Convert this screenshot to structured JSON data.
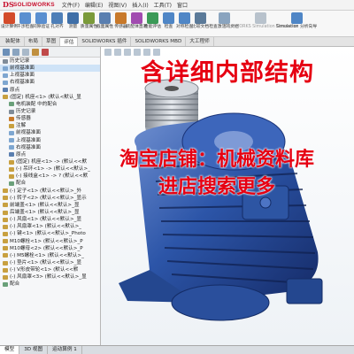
{
  "app": {
    "brand": "SOLIDWORKS",
    "brand_mark": "DS"
  },
  "menu": [
    "文件(F)",
    "编辑(E)",
    "视图(V)",
    "插入(I)",
    "工具(T)",
    "窗口"
  ],
  "ribbon": [
    {
      "label": "设计算例",
      "icon": "design-study-icon",
      "color": "#d34b2a"
    },
    {
      "label": "干涉检查",
      "icon": "interference-icon",
      "color": "#5a8fd0"
    },
    {
      "label": "间隙验证",
      "icon": "clearance-icon",
      "color": "#5a8fd0"
    },
    {
      "label": "孔对齐",
      "icon": "hole-align-icon",
      "color": "#4e7fb8"
    },
    {
      "label": "测量",
      "icon": "measure-icon",
      "color": "#3f6fa8"
    },
    {
      "label": "质量属性",
      "icon": "mass-props-icon",
      "color": "#7a9a3a"
    },
    {
      "label": "截面属性",
      "icon": "section-props-icon",
      "color": "#5a7fb0"
    },
    {
      "label": "传感器",
      "icon": "sensor-icon",
      "color": "#c8792a"
    },
    {
      "label": "装配体直观",
      "icon": "assembly-visual-icon",
      "color": "#a14bb0"
    },
    {
      "label": "性能评估",
      "icon": "performance-icon",
      "color": "#3b9a57"
    },
    {
      "label": "检查",
      "icon": "check-icon",
      "color": "#4f86c6"
    },
    {
      "label": "对称检查",
      "icon": "symmetry-icon",
      "color": "#4f86c6"
    },
    {
      "label": "比较文档",
      "icon": "compare-icon",
      "color": "#5b7a99"
    },
    {
      "label": "检查激活的文档",
      "icon": "check-active-icon",
      "color": "#8aa4bf"
    },
    {
      "label": "SOLIDWORKS Simulation Connector",
      "icon": "sim-connector-icon",
      "color": "#b8c2cc"
    },
    {
      "label": "Simulation 分析向导",
      "icon": "simulation-icon",
      "color": "#4f86c6"
    }
  ],
  "tabs": [
    "装配体",
    "布局",
    "草图",
    "评估",
    "SOLIDWORKS 插件",
    "SOLIDWORKS MBD",
    "大工程师"
  ],
  "active_tab_index": 3,
  "tree": [
    {
      "label": "历史记录",
      "color": "#7f8c99"
    },
    {
      "label": "前视基准面",
      "color": "#7ea6d0",
      "selected": true
    },
    {
      "label": "上视基准面",
      "color": "#7ea6d0"
    },
    {
      "label": "右视基准面",
      "color": "#7ea6d0"
    },
    {
      "label": "原点",
      "color": "#5a7fb0"
    },
    {
      "label": "(固定) 机座<1> (默认<默认_显",
      "color": "#c8a040"
    },
    {
      "label": "电机装配 中的配合",
      "color": "#6aa07a"
    },
    {
      "label": "历史记录",
      "color": "#7f8c99"
    },
    {
      "label": "传感器",
      "color": "#c8792a"
    },
    {
      "label": "注解",
      "color": "#c8a040"
    },
    {
      "label": "前视基准面",
      "color": "#7ea6d0"
    },
    {
      "label": "上视基准面",
      "color": "#7ea6d0"
    },
    {
      "label": "右视基准面",
      "color": "#7ea6d0"
    },
    {
      "label": "原点",
      "color": "#5a7fb0"
    },
    {
      "label": "(固定) 机座<1> -> (默认<<默",
      "color": "#c8a040"
    },
    {
      "label": "(-) 吊环<1> -> (默认<<默认>_",
      "color": "#c8a040"
    },
    {
      "label": "(-) 接线盒<1> -> ? (默认<<默",
      "color": "#c8a040"
    },
    {
      "label": "配合",
      "color": "#6aa07a"
    },
    {
      "label": "(-) 定子<1> (默认<<默认>_外",
      "color": "#c8a040"
    },
    {
      "label": "(-) 转子<2> (默认<<默认>_显示",
      "color": "#c8a040"
    },
    {
      "label": "前端盖<1> (默认<<默认>_显",
      "color": "#c8a040"
    },
    {
      "label": "后端盖<1> (默认<<默认>_显",
      "color": "#c8a040"
    },
    {
      "label": "(-) 风扇<1> (默认<<默认>_显",
      "color": "#c8a040"
    },
    {
      "label": "(-) 风扇罩<1> (默认<<默认>_",
      "color": "#c8a040"
    },
    {
      "label": "(-) 键<1> (默认<<默认>_Photo",
      "color": "#c8a040"
    },
    {
      "label": "M10螺栓<1> (默认<<默认>_P",
      "color": "#c8a040"
    },
    {
      "label": "M10螺母<2> (默认<<默认>_P",
      "color": "#c8a040"
    },
    {
      "label": "(-) M5螺栓<1> (默认<<默认>_",
      "color": "#c8a040"
    },
    {
      "label": "(-) 垫片<1> (默认<<默认>_显",
      "color": "#c8a040"
    },
    {
      "label": "(-) V形皮带轮<1> (默认<<默",
      "color": "#c8a040"
    },
    {
      "label": "(-) 风扇罩<3> (默认<<默认>_显",
      "color": "#c8a040"
    },
    {
      "label": "配合",
      "color": "#6aa07a"
    }
  ],
  "headlines": {
    "top": "含详细内部结构",
    "mid1": "淘宝店铺：机械资料库",
    "mid2": "进店搜索更多"
  },
  "bottom_tabs": [
    "模型",
    "3D 视图",
    "运动算例 1"
  ],
  "active_bottom_tab_index": 0
}
